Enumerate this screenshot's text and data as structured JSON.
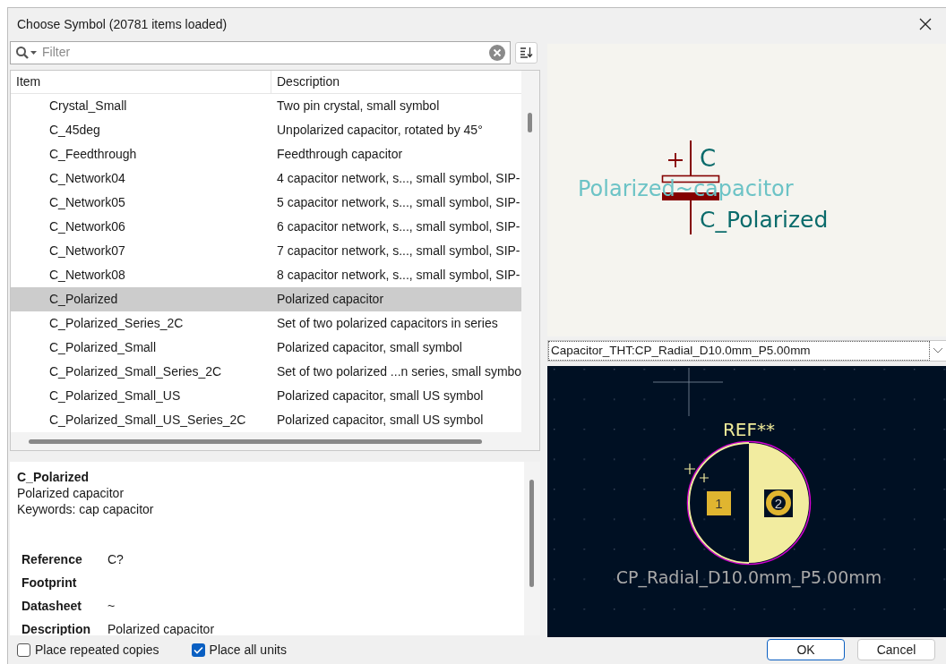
{
  "window": {
    "title": "Choose Symbol (20781 items loaded)"
  },
  "filter": {
    "placeholder": "Filter"
  },
  "table": {
    "columns": [
      "Item",
      "Description"
    ],
    "rows": [
      {
        "item": "Crystal_Small",
        "description": "Two pin crystal, small symbol",
        "selected": false
      },
      {
        "item": "C_45deg",
        "description": "Unpolarized capacitor, rotated by 45°",
        "selected": false
      },
      {
        "item": "C_Feedthrough",
        "description": "Feedthrough capacitor",
        "selected": false
      },
      {
        "item": "C_Network04",
        "description": "4 capacitor network, s..., small symbol, SIP-",
        "selected": false
      },
      {
        "item": "C_Network05",
        "description": "5 capacitor network, s..., small symbol, SIP-",
        "selected": false
      },
      {
        "item": "C_Network06",
        "description": "6 capacitor network, s..., small symbol, SIP-",
        "selected": false
      },
      {
        "item": "C_Network07",
        "description": "7 capacitor network, s..., small symbol, SIP-",
        "selected": false
      },
      {
        "item": "C_Network08",
        "description": "8 capacitor network, s..., small symbol, SIP-",
        "selected": false
      },
      {
        "item": "C_Polarized",
        "description": "Polarized capacitor",
        "selected": true
      },
      {
        "item": "C_Polarized_Series_2C",
        "description": "Set of two polarized capacitors in series",
        "selected": false
      },
      {
        "item": "C_Polarized_Small",
        "description": "Polarized capacitor, small symbol",
        "selected": false
      },
      {
        "item": "C_Polarized_Small_Series_2C",
        "description": "Set of two polarized ...n series, small symbo",
        "selected": false
      },
      {
        "item": "C_Polarized_Small_US",
        "description": "Polarized capacitor, small US symbol",
        "selected": false
      },
      {
        "item": "C_Polarized_Small_US_Series_2C",
        "description": "Polarized capacitor, small US symbol",
        "selected": false
      }
    ]
  },
  "details": {
    "name": "C_Polarized",
    "description": "Polarized capacitor",
    "keywords": "Keywords: cap capacitor",
    "fields": [
      {
        "label": "Reference",
        "value": "C?"
      },
      {
        "label": "Footprint"
      },
      {
        "label": "Datasheet",
        "value": "~"
      },
      {
        "label": "Description",
        "value": "Polarized capacitor"
      }
    ]
  },
  "symbol_preview": {
    "reference": "C",
    "description_text": "Polarized~capacitor",
    "name": "C_Polarized"
  },
  "footprint": {
    "selected": "Capacitor_THT:CP_Radial_D10.0mm_P5.00mm",
    "reference": "REF**",
    "pads": [
      "1",
      "2"
    ],
    "value": "CP_Radial_D10.0mm_P5.00mm"
  },
  "options": [
    {
      "label": "Place repeated copies",
      "checked": false
    },
    {
      "label": "Place all units",
      "checked": true
    }
  ],
  "buttons": [
    {
      "label": "OK",
      "default": true
    },
    {
      "label": "Cancel",
      "default": false
    }
  ]
}
